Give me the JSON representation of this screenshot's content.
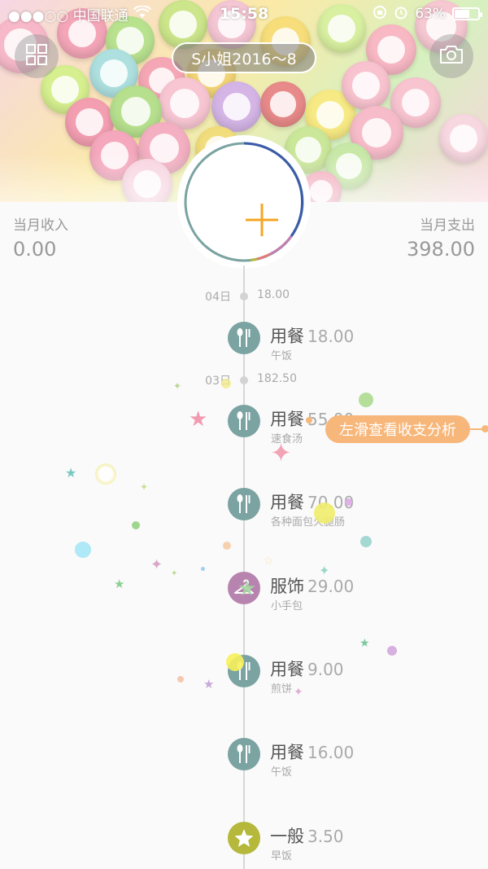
{
  "status_bar": {
    "carrier": "●●●○○ 中国联通",
    "time": "15:58",
    "battery_percent": "63%",
    "battery_level": 0.63
  },
  "header": {
    "account_title": "S小姐2016～8",
    "menu_icon": "grid-icon",
    "camera_icon": "camera-icon",
    "add_icon": "plus-icon"
  },
  "summary": {
    "income_label": "当月收入",
    "income_value": "0.00",
    "expense_label": "当月支出",
    "expense_value": "398.00"
  },
  "timeline": {
    "dates": [
      {
        "day": "04日",
        "total": "18.00"
      },
      {
        "day": "03日",
        "total": "182.50"
      }
    ],
    "entries": [
      {
        "category": "用餐",
        "amount": "18.00",
        "note": "午饭",
        "icon": "fork-knife-icon",
        "color": "#7aa3a1"
      },
      {
        "category": "用餐",
        "amount": "55.00",
        "note": "速食汤",
        "icon": "fork-knife-icon",
        "color": "#7aa3a1"
      },
      {
        "category": "用餐",
        "amount": "70.00",
        "note": "各种面包火腿肠",
        "icon": "fork-knife-icon",
        "color": "#7aa3a1"
      },
      {
        "category": "服饰",
        "amount": "29.00",
        "note": "小手包",
        "icon": "hanger-icon",
        "color": "#b784b0"
      },
      {
        "category": "用餐",
        "amount": "9.00",
        "note": "煎饼",
        "icon": "fork-knife-icon",
        "color": "#7aa3a1"
      },
      {
        "category": "用餐",
        "amount": "16.00",
        "note": "午饭",
        "icon": "fork-knife-icon",
        "color": "#7aa3a1"
      },
      {
        "category": "一般",
        "amount": "3.50",
        "note": "早饭",
        "icon": "star-icon",
        "color": "#b5b83a"
      }
    ]
  },
  "hint": {
    "text": "左滑查看收支分析"
  },
  "colors": {
    "accent_orange": "#f5a623",
    "hint_orange": "#f7b77a",
    "food_teal": "#7aa3a1",
    "clothing_purple": "#b784b0",
    "general_olive": "#b5b83a"
  }
}
